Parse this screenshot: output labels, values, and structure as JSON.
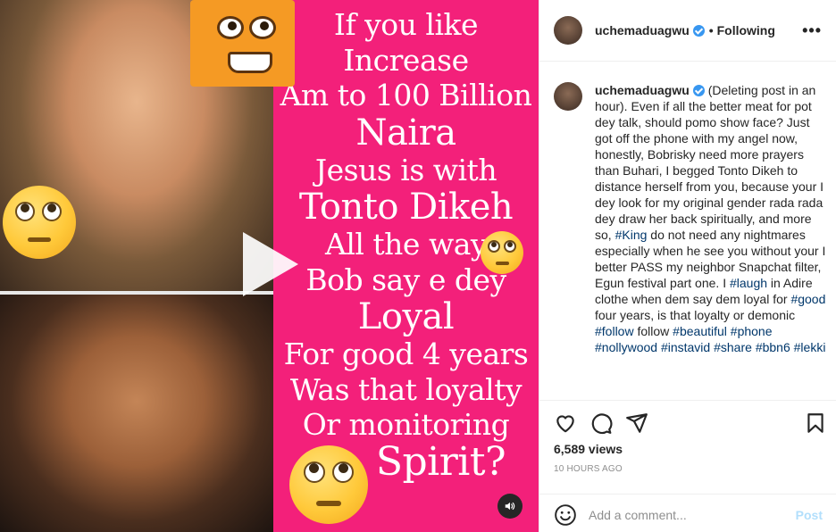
{
  "post": {
    "username": "uchemaduagwu",
    "follow_status": "Following",
    "more_label": "•••",
    "caption_username": "uchemaduagwu",
    "caption_parts": [
      {
        "t": " (Deleting post in an hour). Even if all the better meat for pot dey talk, should pomo show face? Just got off the phone with my angel now, honestly, Bobrisky need more prayers than Buhari, I begged Tonto Dikeh to distance herself from you, because your I dey look for my original gender rada rada dey draw her back spiritually, and more so, ",
        "tag": false
      },
      {
        "t": "#King",
        "tag": true
      },
      {
        "t": " do not need any nightmares especially when he see you without your I better PASS my neighbor Snapchat filter, Egun festival part one. I ",
        "tag": false
      },
      {
        "t": "#laugh",
        "tag": true
      },
      {
        "t": " in Adire clothe when dem say dem loyal for ",
        "tag": false
      },
      {
        "t": "#good",
        "tag": true
      },
      {
        "t": " four years, is that loyalty or demonic ",
        "tag": false
      },
      {
        "t": "#follow",
        "tag": true
      },
      {
        "t": " follow ",
        "tag": false
      },
      {
        "t": "#beautiful",
        "tag": true
      },
      {
        "t": " ",
        "tag": false
      },
      {
        "t": "#phone",
        "tag": true
      },
      {
        "t": " ",
        "tag": false
      },
      {
        "t": "#nollywood",
        "tag": true
      },
      {
        "t": " ",
        "tag": false
      },
      {
        "t": "#instavid",
        "tag": true
      },
      {
        "t": " ",
        "tag": false
      },
      {
        "t": "#share",
        "tag": true
      },
      {
        "t": " ",
        "tag": false
      },
      {
        "t": "#bbn6",
        "tag": true
      },
      {
        "t": " ",
        "tag": false
      },
      {
        "t": "#lekki",
        "tag": true
      }
    ],
    "views": "6,589 views",
    "time": "10 HOURS AGO",
    "comment_placeholder": "Add a comment...",
    "post_label": "Post"
  },
  "media_text": [
    "If you like",
    "Increase",
    "Am to 100 Billion",
    "Naira",
    "Jesus is with",
    "Tonto Dikeh",
    "All the way",
    "Bob say e dey",
    "Loyal",
    "For good 4 years",
    "Was that loyalty",
    "Or monitoring",
    "Spirit?"
  ],
  "icons": {
    "like": "heart-icon",
    "comment": "comment-icon",
    "share": "share-icon",
    "save": "bookmark-icon",
    "play": "play-icon",
    "mute": "speaker-icon",
    "emoji": "smile-icon"
  },
  "colors": {
    "accent": "#3897f0",
    "media_background": "#f3207a",
    "hashtag": "#00376b",
    "post_disabled": "#b2dffc"
  }
}
